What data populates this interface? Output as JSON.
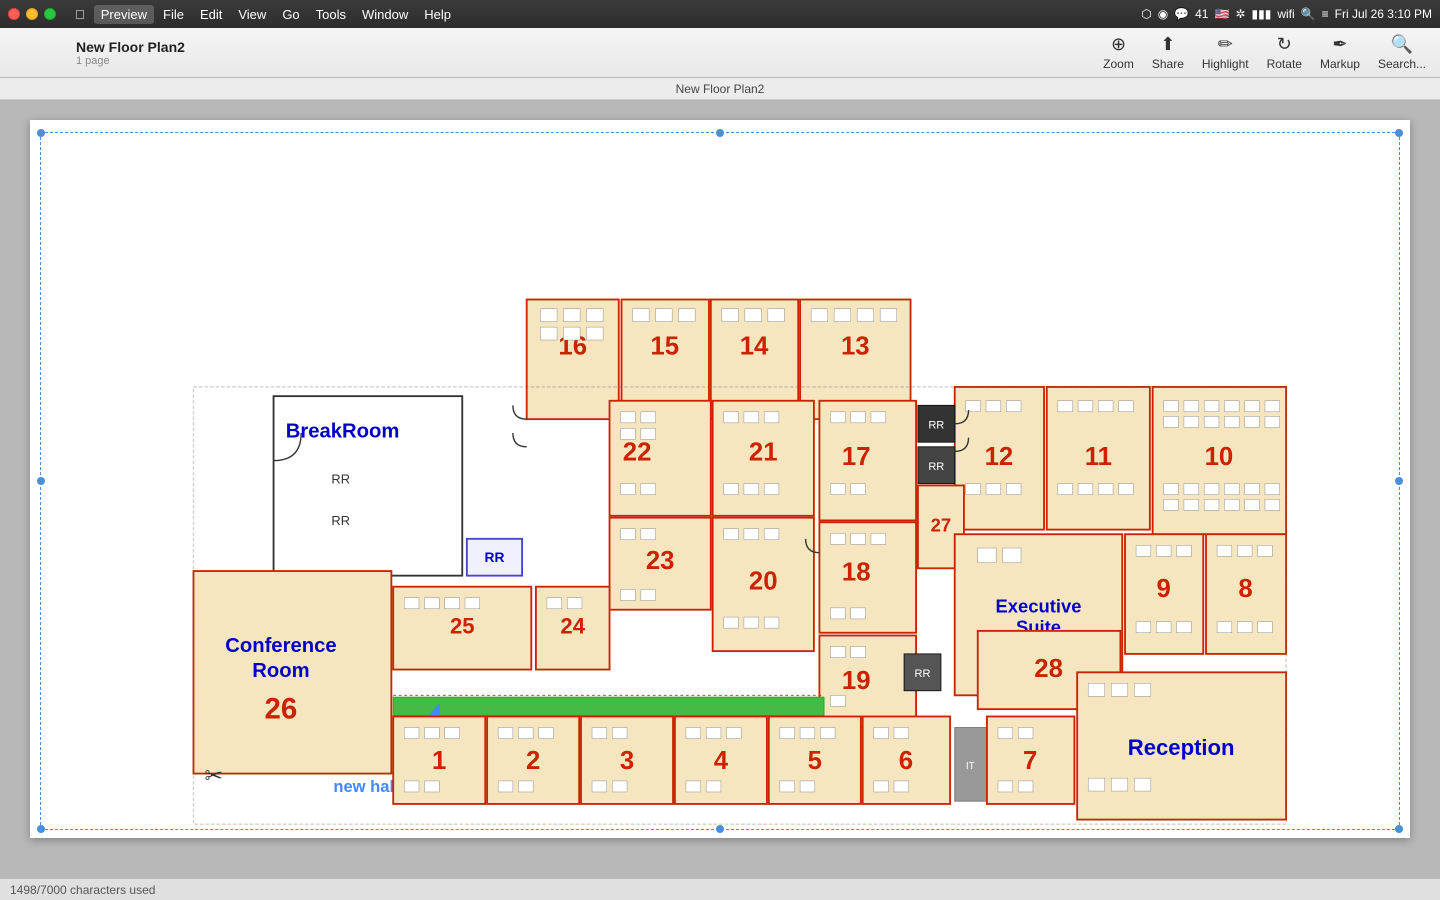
{
  "titlebar": {
    "menu_items": [
      "Apple",
      "Preview",
      "File",
      "Edit",
      "View",
      "Go",
      "Tools",
      "Window",
      "Help"
    ],
    "system_time": "Fri Jul 26  3:10 PM"
  },
  "toolbar": {
    "doc_title": "New Floor Plan2",
    "doc_pages": "1 page",
    "actions": [
      "Zoom",
      "Share",
      "Highlight",
      "Rotate",
      "Markup",
      "Search..."
    ]
  },
  "doc_title_bar": {
    "title": "New Floor Plan2"
  },
  "floor_plan": {
    "rooms": [
      {
        "id": "1",
        "label": "1"
      },
      {
        "id": "2",
        "label": "2"
      },
      {
        "id": "3",
        "label": "3"
      },
      {
        "id": "4",
        "label": "4"
      },
      {
        "id": "5",
        "label": "5"
      },
      {
        "id": "6",
        "label": "6"
      },
      {
        "id": "7",
        "label": "7"
      },
      {
        "id": "8",
        "label": "8"
      },
      {
        "id": "9",
        "label": "9"
      },
      {
        "id": "10",
        "label": "10"
      },
      {
        "id": "11",
        "label": "11"
      },
      {
        "id": "12",
        "label": "12"
      },
      {
        "id": "13",
        "label": "13"
      },
      {
        "id": "14",
        "label": "14"
      },
      {
        "id": "15",
        "label": "15"
      },
      {
        "id": "16",
        "label": "16"
      },
      {
        "id": "17",
        "label": "17"
      },
      {
        "id": "18",
        "label": "18"
      },
      {
        "id": "19",
        "label": "19"
      },
      {
        "id": "20",
        "label": "20"
      },
      {
        "id": "21",
        "label": "21"
      },
      {
        "id": "22",
        "label": "22"
      },
      {
        "id": "23",
        "label": "23"
      },
      {
        "id": "24",
        "label": "24"
      },
      {
        "id": "25",
        "label": "25"
      },
      {
        "id": "26",
        "label": "26"
      },
      {
        "id": "27",
        "label": "27"
      },
      {
        "id": "28",
        "label": "28"
      }
    ],
    "special_rooms": [
      {
        "id": "breakroom",
        "label": "BreakRoom"
      },
      {
        "id": "conference",
        "label": "Conference\nRoom"
      },
      {
        "id": "executive",
        "label": "Executive\nSuite"
      },
      {
        "id": "reception",
        "label": "Reception"
      }
    ],
    "annotations": [
      {
        "id": "new_hallway",
        "label": "new hallway"
      }
    ]
  },
  "status_bar": {
    "text": "1498/7000 characters used"
  }
}
